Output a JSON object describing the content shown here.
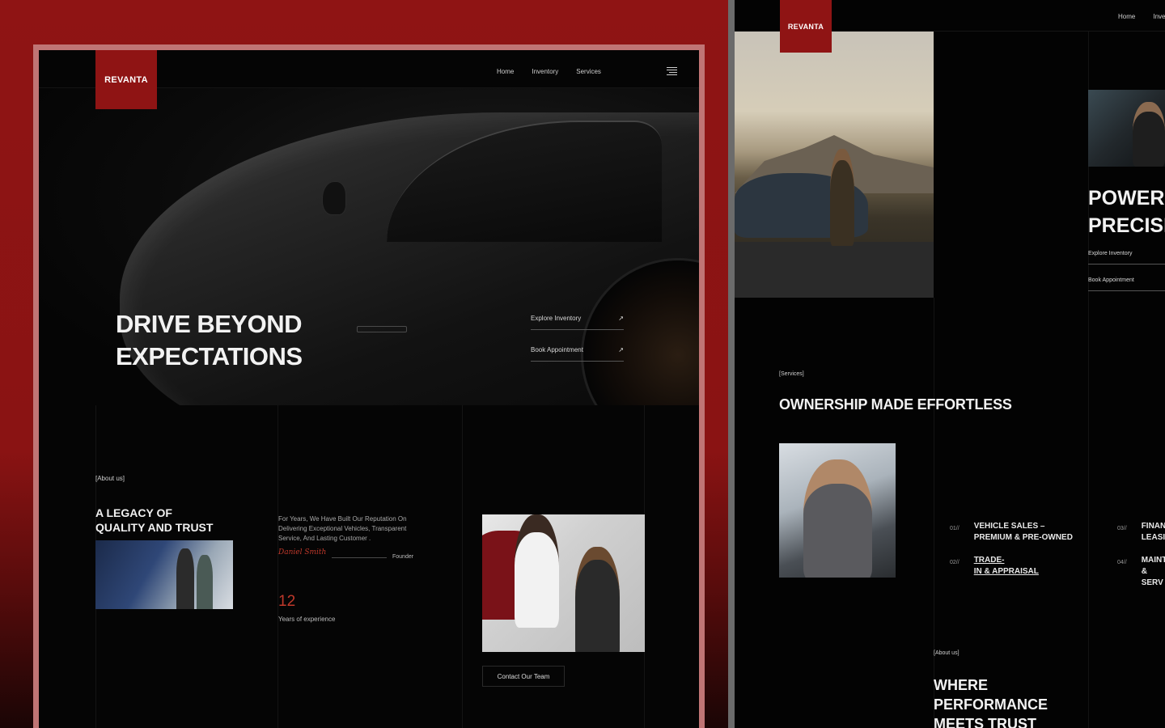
{
  "left": {
    "brand": "REVANTA",
    "nav": [
      "Home",
      "Inventory",
      "Services"
    ],
    "hero": {
      "title_line1": "DRIVE BEYOND",
      "title_line2": "EXPECTATIONS",
      "links": [
        "Explore Inventory",
        "Book Appointment"
      ]
    },
    "about": {
      "tag": "[About us]",
      "heading_line1": "A LEGACY OF",
      "heading_line2": "QUALITY AND TRUST",
      "paragraph": "For Years, We Have Built Our Reputation On Delivering Exceptional Vehicles, Transparent Service, And Lasting Customer .",
      "signature": "Daniel Smith",
      "role": "Founder",
      "stat_value": "12",
      "stat_label": "Years of experience",
      "cta": "Contact Our Team"
    }
  },
  "right": {
    "brand": "REVANTA",
    "nav": [
      "Home",
      "Inven"
    ],
    "hero": {
      "title_line1": "POWER",
      "title_line2": "PRECISI",
      "links": [
        "Explore Inventory",
        "Book Appointment"
      ]
    },
    "services": {
      "tag": "[Services]",
      "heading": "OWNERSHIP MADE EFFORTLESS",
      "items": [
        {
          "num": "01//",
          "line1": "VEHICLE SALES –",
          "line2": "PREMIUM & PRE-OWNED"
        },
        {
          "num": "02//",
          "line1": "TRADE-",
          "line2": "IN & APPRAISAL"
        },
        {
          "num": "03//",
          "line1": "FINAN",
          "line2": "LEASI"
        },
        {
          "num": "04//",
          "line1": "MAINT",
          "line2": "& SERV"
        }
      ]
    },
    "about": {
      "tag": "[About us]",
      "heading_line1": "WHERE",
      "heading_line2": "PERFORMANCE",
      "heading_line3": "MEETS TRUST"
    }
  },
  "icons": {
    "arrow": "↗",
    "menu": "hamburger-icon"
  },
  "colors": {
    "brand_red": "#8f1414",
    "accent_red": "#c0392b",
    "background": "#050505"
  }
}
